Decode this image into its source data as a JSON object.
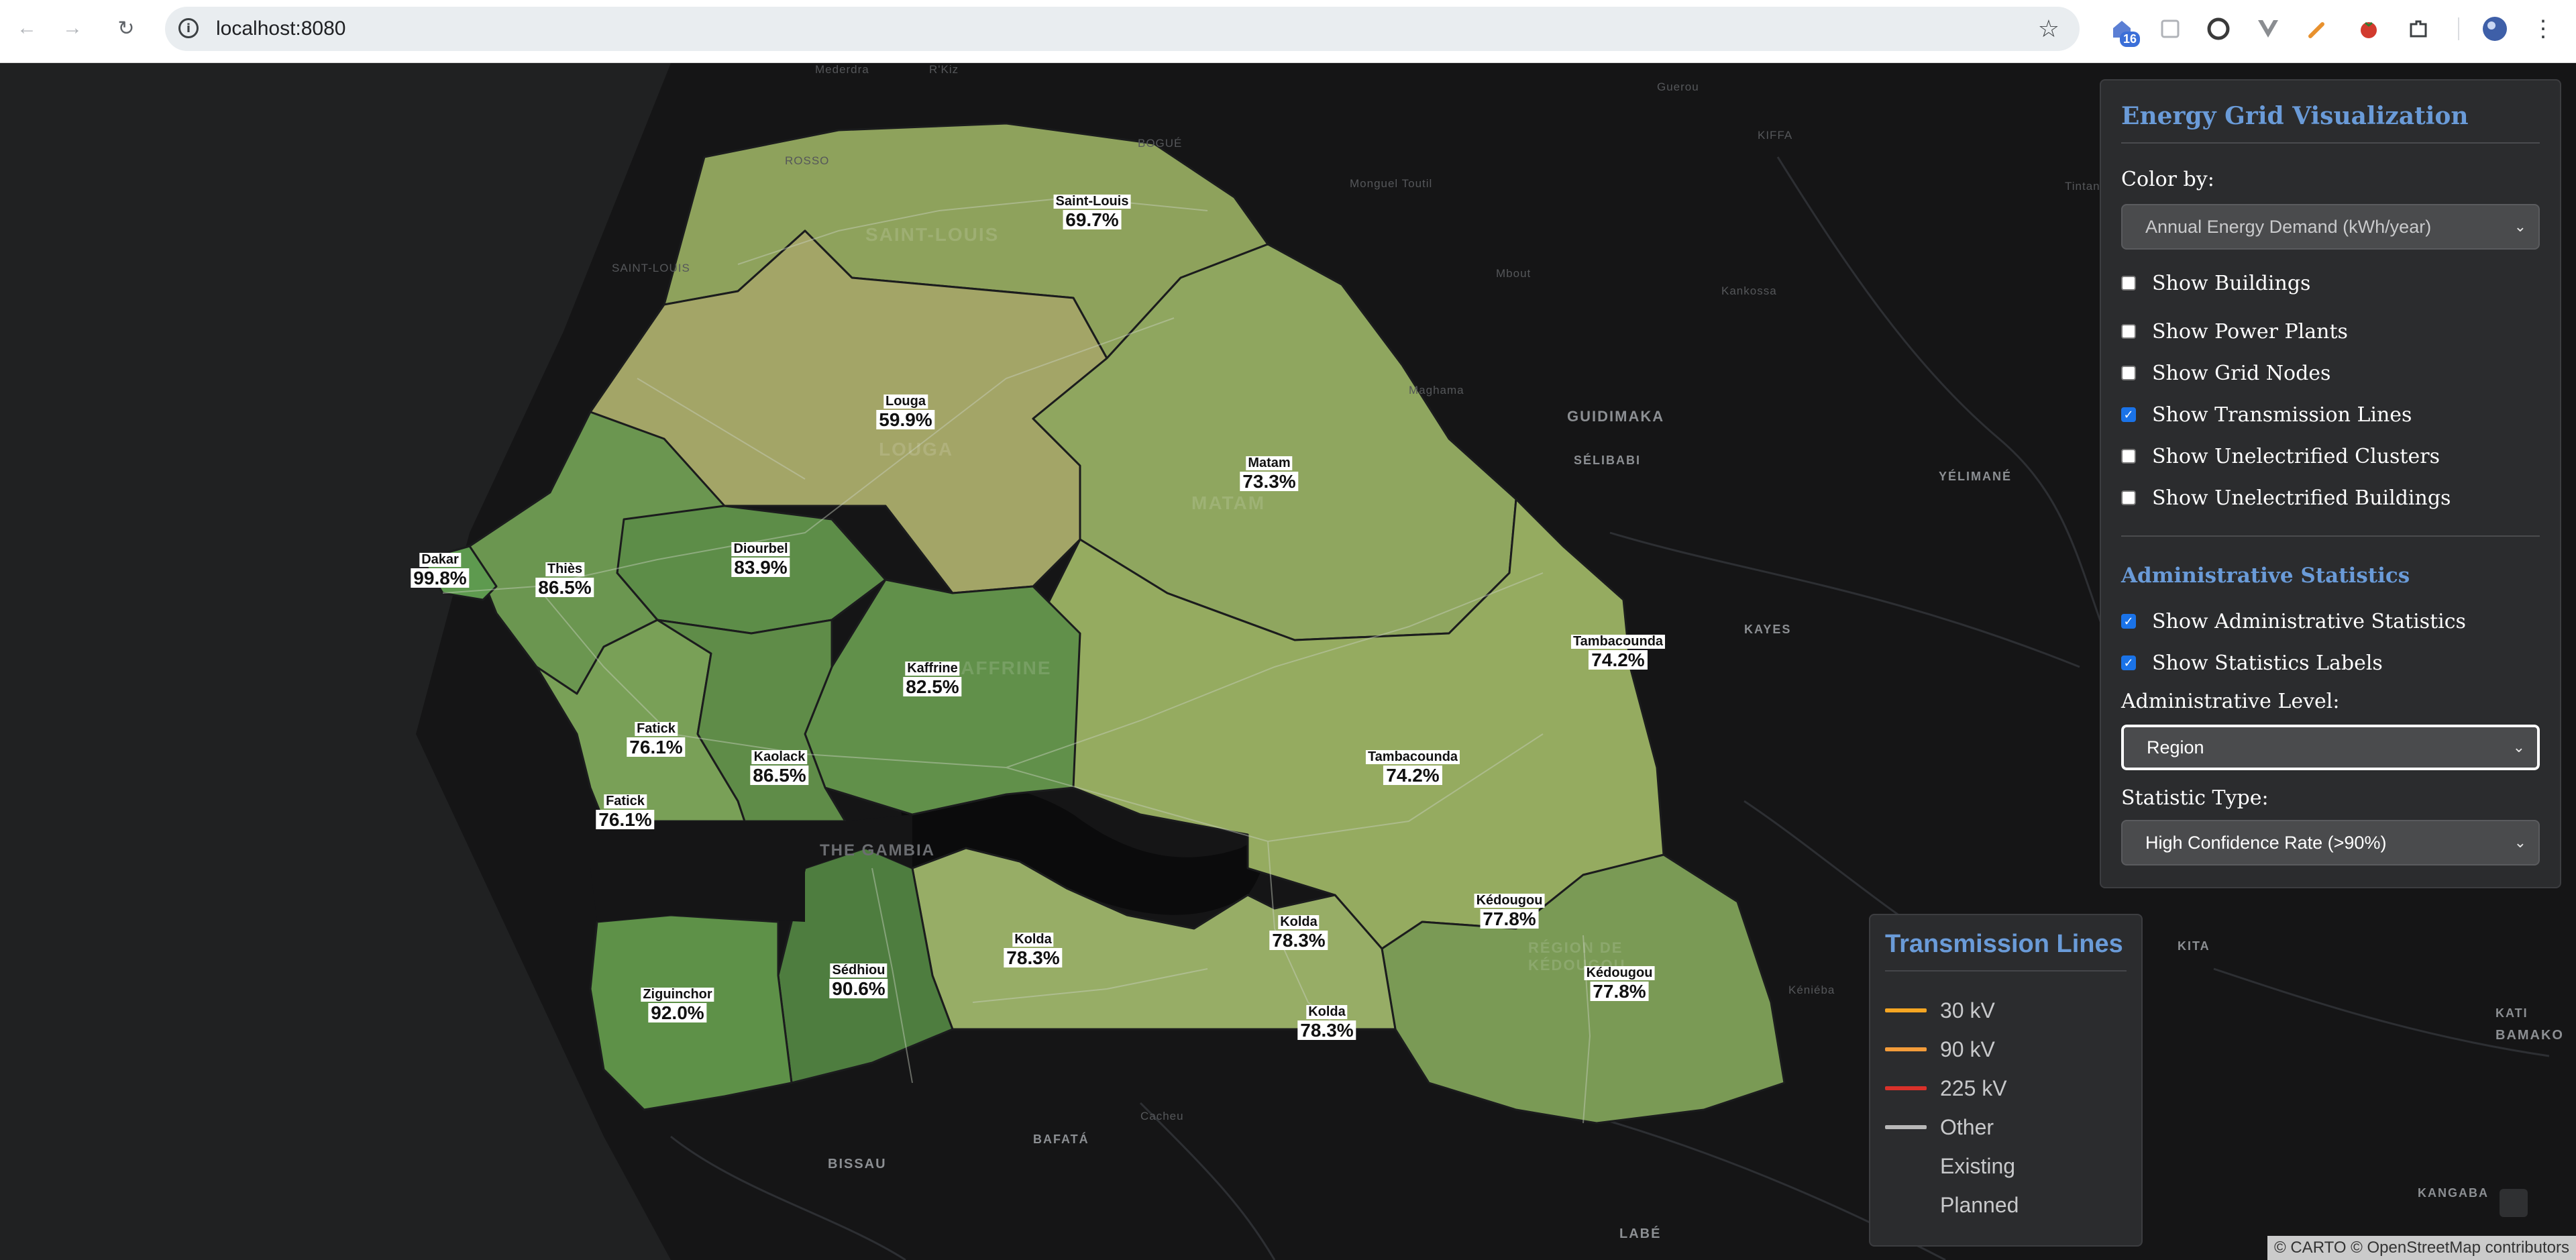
{
  "browser": {
    "url": "localhost:8080",
    "extension_badge": "16",
    "icons": [
      "back-arrow-icon",
      "forward-arrow-icon",
      "reload-icon",
      "site-info-icon",
      "bookmark-star-icon",
      "extension-home-icon",
      "extension-grid-icon",
      "grammarly-icon",
      "vue-devtools-icon",
      "color-picker-icon",
      "tomato-icon",
      "puzzle-extensions-icon",
      "profile-avatar-icon",
      "kebab-menu-icon"
    ]
  },
  "panel": {
    "title": "Energy Grid Visualization",
    "color_by_label": "Color by:",
    "color_by_value": "Annual Energy Demand (kWh/year)",
    "layers": [
      {
        "label": "Show Buildings",
        "checked": false
      },
      {
        "label": "Show Power Plants",
        "checked": false
      },
      {
        "label": "Show Grid Nodes",
        "checked": false
      },
      {
        "label": "Show Transmission Lines",
        "checked": true
      },
      {
        "label": "Show Unelectrified Clusters",
        "checked": false
      },
      {
        "label": "Show Unelectrified Buildings",
        "checked": false
      }
    ],
    "admin_stats_title": "Administrative Statistics",
    "admin_options": [
      {
        "label": "Show Administrative Statistics",
        "checked": true
      },
      {
        "label": "Show Statistics Labels",
        "checked": true
      }
    ],
    "admin_level_label": "Administrative Level:",
    "admin_level_value": "Region",
    "stat_type_label": "Statistic Type:",
    "stat_type_value": "High Confidence Rate (>90%)"
  },
  "legend": {
    "title": "Transmission Lines",
    "items": [
      {
        "label": "30 kV",
        "color": "#f5a623"
      },
      {
        "label": "90 kV",
        "color": "#f39c3a"
      },
      {
        "label": "225 kV",
        "color": "#d9312a"
      },
      {
        "label": "Other",
        "color": "#b8b8b8"
      },
      {
        "label": "Existing",
        "color": null
      },
      {
        "label": "Planned",
        "color": null
      }
    ]
  },
  "map": {
    "attribution": "© CARTO © OpenStreetMap contributors",
    "region_stats": [
      {
        "name": "Saint-Louis",
        "value": "69.7%"
      },
      {
        "name": "Louga",
        "value": "59.9%"
      },
      {
        "name": "Matam",
        "value": "73.3%"
      },
      {
        "name": "Dakar",
        "value": "99.8%"
      },
      {
        "name": "Thiès",
        "value": "86.5%"
      },
      {
        "name": "Diourbel",
        "value": "83.9%"
      },
      {
        "name": "Kaffrine",
        "value": "82.5%"
      },
      {
        "name": "Tambacounda",
        "value": "74.2%"
      },
      {
        "name": "Tambacounda",
        "value": "74.2%"
      },
      {
        "name": "Fatick",
        "value": "76.1%"
      },
      {
        "name": "Fatick",
        "value": "76.1%"
      },
      {
        "name": "Kaolack",
        "value": "86.5%"
      },
      {
        "name": "Kédougou",
        "value": "77.8%"
      },
      {
        "name": "Kédougou",
        "value": "77.8%"
      },
      {
        "name": "Kolda",
        "value": "78.3%"
      },
      {
        "name": "Kolda",
        "value": "78.3%"
      },
      {
        "name": "Kolda",
        "value": "78.3%"
      },
      {
        "name": "Sédhiou",
        "value": "90.6%"
      },
      {
        "name": "Ziguinchor",
        "value": "92.0%"
      }
    ],
    "place_names": [
      "Mederdra",
      "R'Kiz",
      "ROSSO",
      "BOGUÉ",
      "KIFFA",
      "Monguel Toutil",
      "Tintane",
      "Guerou",
      "Mbout",
      "Kankossa",
      "Maghama",
      "GUIDIMAKA",
      "SÉLIBABI",
      "YÉLIMANÉ",
      "KAYES",
      "KITA",
      "KATI",
      "BAMAKO",
      "Kéniéba",
      "KANGABA",
      "LABÉ",
      "BAFATÁ",
      "Cacheu",
      "BISSAU"
    ],
    "watermarks": [
      "SAINT-LOUIS",
      "LOUGA",
      "MATAM",
      "KAFFRINE",
      "THE GAMBIA",
      "RÉGION DE KÉDOUGOU",
      "SAINT-LOUIS"
    ]
  }
}
